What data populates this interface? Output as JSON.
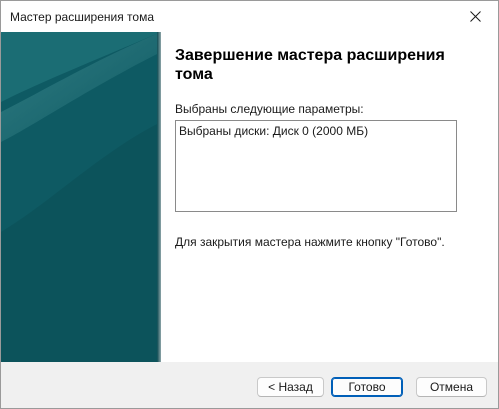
{
  "window": {
    "title": "Мастер расширения тома",
    "close_icon": "close-icon"
  },
  "banner": {
    "colors": {
      "dark": "#0b4a52",
      "mid": "#0e5a63",
      "light": "#2a7f85"
    }
  },
  "content": {
    "heading": "Завершение мастера расширения тома",
    "params_label": "Выбраны следующие параметры:",
    "params_text": "Выбраны диски: Диск 0 (2000 МБ)",
    "hint": "Для закрытия мастера нажмите кнопку \"Готово\"."
  },
  "footer": {
    "back_label": "< Назад",
    "done_label": "Готово",
    "cancel_label": "Отмена"
  },
  "accent_color": "#005fb8"
}
